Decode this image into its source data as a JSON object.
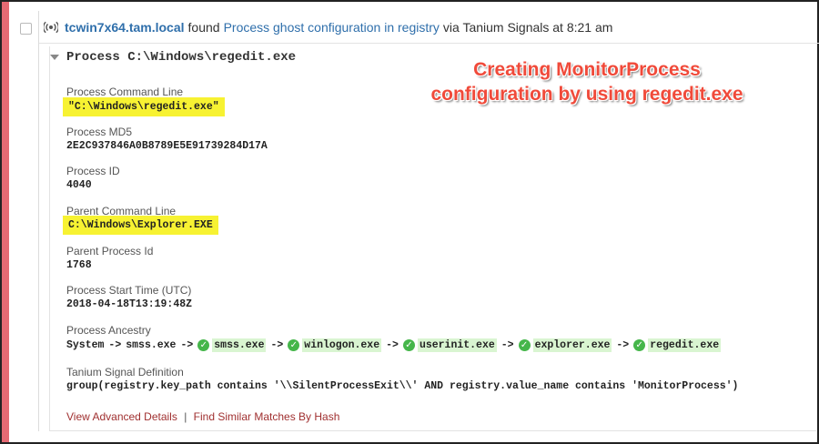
{
  "header": {
    "host": "tcwin7x64.tam.local",
    "found_text": "found",
    "signal_name": "Process ghost configuration in registry",
    "via_text": "via Tanium Signals at 8:21 am"
  },
  "process": {
    "title": "Process C:\\Windows\\regedit.exe"
  },
  "annotation": {
    "line1": "Creating MonitorProcess",
    "line2": "configuration by using regedit.exe"
  },
  "fields": {
    "command_line_label": "Process Command Line",
    "command_line_value": "\"C:\\Windows\\regedit.exe\"",
    "md5_label": "Process MD5",
    "md5_value": "2E2C937846A0B8789E5E91739284D17A",
    "pid_label": "Process ID",
    "pid_value": "4040",
    "parent_cmd_label": "Parent Command Line",
    "parent_cmd_value": "C:\\Windows\\Explorer.EXE",
    "parent_pid_label": "Parent Process Id",
    "parent_pid_value": "1768",
    "start_time_label": "Process Start Time (UTC)",
    "start_time_value": "2018-04-18T13:19:48Z",
    "ancestry_label": "Process Ancestry",
    "ancestry": {
      "system": "System",
      "smss_plain": "smss.exe",
      "smss": "smss.exe",
      "winlogon": "winlogon.exe",
      "userinit": "userinit.exe",
      "explorer": "explorer.exe",
      "regedit": "regedit.exe",
      "arrow": "->"
    },
    "definition_label": "Tanium Signal Definition",
    "definition_value": "group(registry.key_path contains '\\\\SilentProcessExit\\\\' AND registry.value_name contains 'MonitorProcess')"
  },
  "footer": {
    "advanced_details": "View Advanced Details",
    "separator": "|",
    "similar_matches": "Find Similar Matches By Hash"
  },
  "colors": {
    "accent_link": "#2f6fab",
    "highlight": "#f7f232",
    "annotation": "#f04a3a",
    "status_bar": "#e56a73"
  }
}
